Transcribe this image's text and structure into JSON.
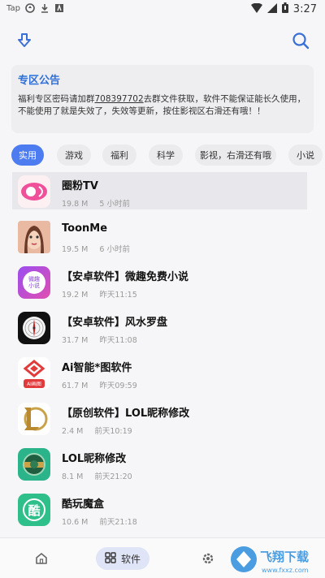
{
  "status_bar": {
    "left_text": "Tap",
    "time": "3:27"
  },
  "notice": {
    "title": "专区公告",
    "text_before": "福利专区密码请加群",
    "group_number": "708397702",
    "text_after": "去群文件获取，软件不能保证能长久使用，不能使用了就是失效了，失效等更新，按住影视区右滑还有哦！！"
  },
  "categories": [
    "实用",
    "游戏",
    "福利",
    "科学",
    "影视，右滑还有哦",
    "小说"
  ],
  "apps": [
    {
      "name": "圈粉TV",
      "size": "19.8 M",
      "time": "5 小时前"
    },
    {
      "name": "ToonMe",
      "size": "19.5 M",
      "time": "6 小时前"
    },
    {
      "name": "【安卓软件】微趣免费小说",
      "size": "19.2 M",
      "time": "昨天11:15"
    },
    {
      "name": "【安卓软件】风水罗盘",
      "size": "31.7 M",
      "time": "昨天11:08"
    },
    {
      "name": "Ai智能*图软件",
      "size": "61.7 M",
      "time": "昨天09:59"
    },
    {
      "name": "【原创软件】LOL昵称修改",
      "size": "2.4 M",
      "time": "前天10:19"
    },
    {
      "name": "LOL昵称修改",
      "size": "8.1 M",
      "time": "前天21:20"
    },
    {
      "name": "酷玩魔盒",
      "size": "10.6 M",
      "time": "前天21:18"
    }
  ],
  "icon_text": {
    "weiqu": "微趣\n小说",
    "ai": "AI画图",
    "kuwan": "酷"
  },
  "bottom_nav": {
    "software_label": "软件"
  },
  "watermark": {
    "text": "飞翔下载",
    "url": "www.fxxz.com"
  },
  "colors": {
    "accent": "#4d7cf0",
    "notice_title": "#2f6fd8"
  }
}
